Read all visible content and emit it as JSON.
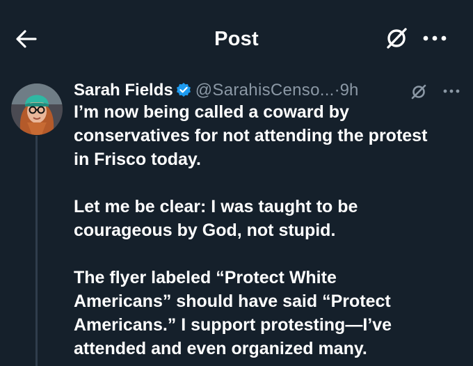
{
  "header": {
    "title": "Post",
    "back_icon": "arrow-left-icon",
    "grok_icon": "grok-slash-icon",
    "more_icon": "more-horizontal-icon"
  },
  "post": {
    "display_name": "Sarah Fields",
    "verified": true,
    "verified_color": "#1d9bf0",
    "handle": "@SarahisCenso...",
    "separator": "·",
    "time": "9h",
    "paragraphs": [
      [
        "I’m now being called a coward by",
        "conservatives for not attending the protest",
        "in Frisco today."
      ],
      [
        "Let me be clear: I was taught to be",
        "courageous by God, not stupid."
      ],
      [
        "The flyer labeled “Protect White",
        "Americans” should have said “Protect",
        "Americans.” I support protesting—I’ve",
        "attended and even organized many."
      ]
    ]
  },
  "colors": {
    "background": "#15202b",
    "secondary_text": "#8b98a5",
    "thread_line": "#2f3d4c"
  }
}
